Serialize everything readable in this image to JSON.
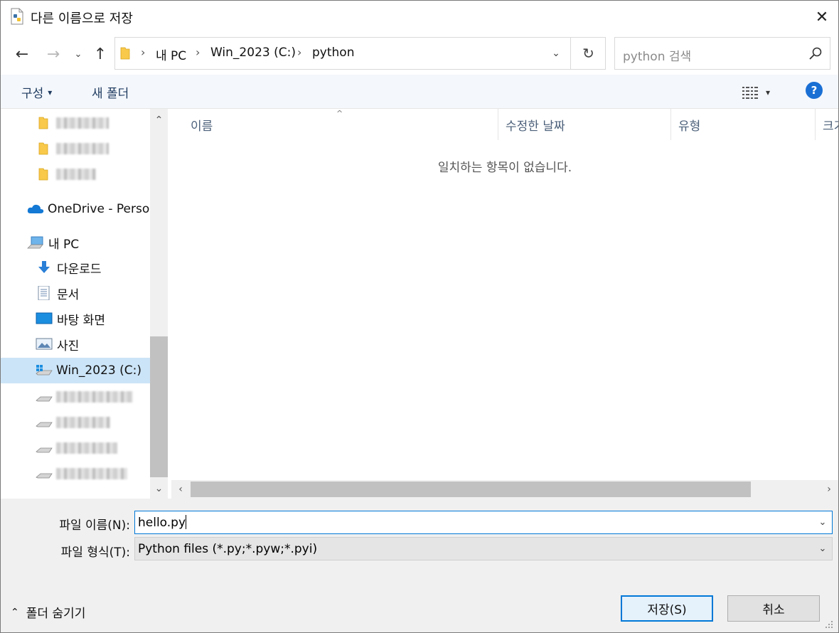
{
  "window": {
    "title": "다른 이름으로 저장",
    "close_glyph": "✕"
  },
  "nav": {
    "back_glyph": "←",
    "forward_glyph": "→",
    "recent_glyph": "⌄",
    "up_glyph": "↑",
    "breadcrumb": [
      "내 PC",
      "Win_2023 (C:)",
      "python"
    ],
    "breadcrumb_sep": "›",
    "dropdown_glyph": "⌄",
    "refresh_glyph": "↻"
  },
  "search": {
    "placeholder": "python 검색"
  },
  "toolbar": {
    "organize_label": "구성",
    "organize_arrow": "▾",
    "new_folder_label": "새 폴더",
    "view_arrow": "▾",
    "help_glyph": "?"
  },
  "navpane": {
    "items": [
      {
        "label": "",
        "icon": "folder-icon",
        "blurred": true
      },
      {
        "label": "",
        "icon": "folder-icon",
        "blurred": true
      },
      {
        "label": "",
        "icon": "folder-icon",
        "blurred": true
      },
      {
        "label": "OneDrive - Person",
        "icon": "onedrive-cloud-icon"
      },
      {
        "label": "내 PC",
        "icon": "computer-icon"
      },
      {
        "label": "다운로드",
        "icon": "download-arrow-icon"
      },
      {
        "label": "문서",
        "icon": "document-icon"
      },
      {
        "label": "바탕 화면",
        "icon": "desktop-icon"
      },
      {
        "label": "사진",
        "icon": "pictures-icon"
      },
      {
        "label": "Win_2023 (C:)",
        "icon": "windows-drive-icon",
        "selected": true
      },
      {
        "label": "",
        "icon": "drive-icon",
        "blurred": true
      },
      {
        "label": "",
        "icon": "drive-icon",
        "blurred": true
      },
      {
        "label": "",
        "icon": "drive-icon",
        "blurred": true
      },
      {
        "label": "",
        "icon": "drive-icon",
        "blurred": true
      }
    ],
    "scroll_up": "⌃",
    "scroll_down": "⌄"
  },
  "filelist": {
    "columns": [
      "이름",
      "수정한 날짜",
      "유형",
      "크기"
    ],
    "sort_glyph": "^",
    "empty_message": "일치하는 항목이 없습니다.",
    "scroll_left": "‹",
    "scroll_right": "›"
  },
  "save_form": {
    "filename_label": "파일 이름(N):",
    "filename_value": "hello.py",
    "filetype_label": "파일 형식(T):",
    "filetype_value": "Python files (*.py;*.pyw;*.pyi)",
    "dropdown_glyph": "⌄"
  },
  "footer": {
    "hide_folders_glyph": "⌃",
    "hide_folders_label": "폴더 숨기기",
    "save_button": "저장(S)",
    "cancel_button": "취소"
  },
  "colors": {
    "accent": "#0078d7",
    "selected_bg": "#cce4f7",
    "help_blue": "#1a6fd4",
    "folder_yellow": "#f8c94a"
  }
}
